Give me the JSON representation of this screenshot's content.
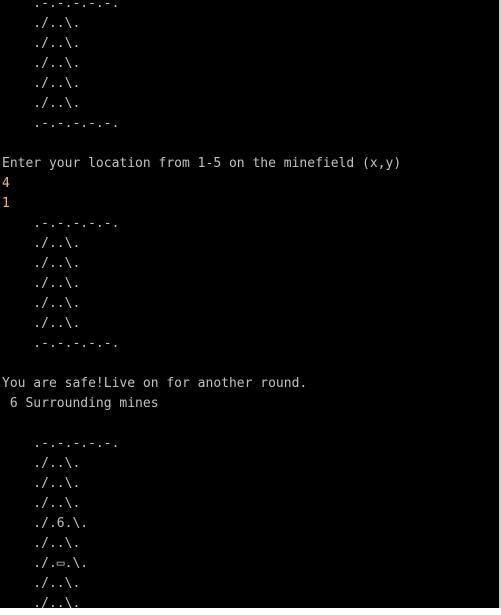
{
  "colors": {
    "background": "#000000",
    "text": "#c0c0c0",
    "user_input": "#e8b48c"
  },
  "console": {
    "lines": [
      {
        "text": "    .-.-.-.-.-.",
        "kind": "output"
      },
      {
        "text": "    ./..\\.",
        "kind": "output"
      },
      {
        "text": "    ./..\\.",
        "kind": "output"
      },
      {
        "text": "    ./..\\.",
        "kind": "output"
      },
      {
        "text": "    ./..\\.",
        "kind": "output"
      },
      {
        "text": "    ./..\\.",
        "kind": "output"
      },
      {
        "text": "    .-.-.-.-.-.",
        "kind": "output"
      },
      {
        "text": "",
        "kind": "output"
      },
      {
        "text": "Enter your location from 1-5 on the minefield (x,y)",
        "kind": "output"
      },
      {
        "text": "4",
        "kind": "input"
      },
      {
        "text": "1",
        "kind": "input"
      },
      {
        "text": "    .-.-.-.-.-.",
        "kind": "output"
      },
      {
        "text": "    ./..\\.",
        "kind": "output"
      },
      {
        "text": "    ./..\\.",
        "kind": "output"
      },
      {
        "text": "    ./..\\.",
        "kind": "output"
      },
      {
        "text": "    ./..\\.",
        "kind": "output"
      },
      {
        "text": "    ./..\\.",
        "kind": "output"
      },
      {
        "text": "    .-.-.-.-.-.",
        "kind": "output"
      },
      {
        "text": "",
        "kind": "output"
      },
      {
        "text": "You are safe!Live on for another round.",
        "kind": "output"
      },
      {
        "text": " 6 Surrounding mines",
        "kind": "output"
      },
      {
        "text": "",
        "kind": "output"
      },
      {
        "text": "    .-.-.-.-.-.",
        "kind": "output"
      },
      {
        "text": "    ./..\\.",
        "kind": "output"
      },
      {
        "text": "    ./..\\.",
        "kind": "output"
      },
      {
        "text": "    ./..\\.",
        "kind": "output"
      },
      {
        "text": "    ./.6.\\.",
        "kind": "output"
      },
      {
        "text": "    ./..\\.",
        "kind": "output"
      },
      {
        "text": "    ./.▭.\\.",
        "kind": "output"
      },
      {
        "text": "    ./..\\.",
        "kind": "output"
      },
      {
        "text": "    ./..\\.",
        "kind": "output"
      }
    ]
  }
}
